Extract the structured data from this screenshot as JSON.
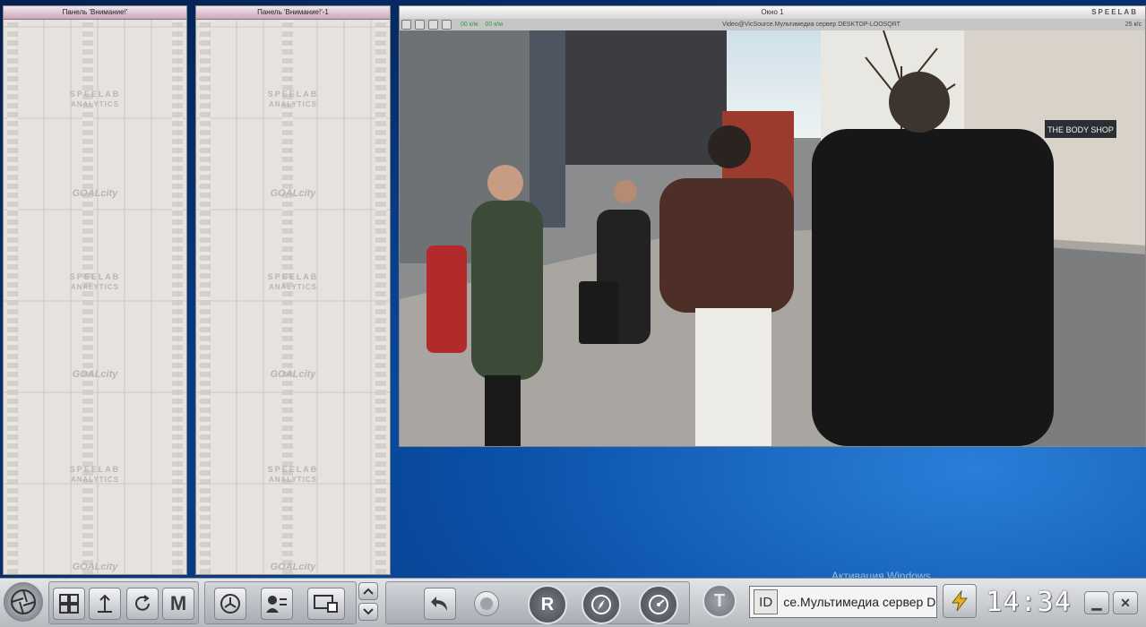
{
  "panels": [
    {
      "title": "Панель 'Внимание!'",
      "brand": "SPEELAB",
      "sub": "ANALYTICS",
      "goal": "GOALcity"
    },
    {
      "title": "Панель 'Внимание!'-1",
      "brand": "SPEELAB",
      "sub": "ANALYTICS",
      "goal": "GOALcity"
    }
  ],
  "camera": {
    "title": "Окно 1",
    "brand": "SPEELAB",
    "speed_in": "00 к/м",
    "speed_out": "00 к/м",
    "source": "Video@VicSource.Мультимедиа сервер DESKTOP-LOOSQRT",
    "fps": "25 к/с",
    "shop_sign": "THE BODY SHOP"
  },
  "taskbar": {
    "menu_label": "M",
    "r_label": "R",
    "t_label": "T",
    "id_label": "ID",
    "id_value": "ce.Мультимедиа сервер DES",
    "clock": "14:34",
    "minimize": "▁",
    "close": "✕"
  },
  "system": {
    "activation": "Активация Windows"
  }
}
